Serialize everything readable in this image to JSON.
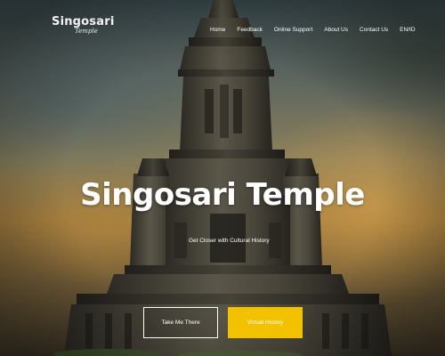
{
  "logo": {
    "main": "Singosari",
    "sub": "Temple"
  },
  "nav": {
    "items": [
      {
        "label": "Home"
      },
      {
        "label": "Feedback"
      },
      {
        "label": "Online Support"
      },
      {
        "label": "About Us"
      },
      {
        "label": "Contact Us"
      },
      {
        "label": "EN/ID"
      }
    ]
  },
  "hero": {
    "title": "Singosari Temple",
    "subtitle": "Get Closer with Cultural History",
    "primary_button": "Take Me There",
    "secondary_button": "Virtual History"
  },
  "colors": {
    "accent": "#f2c200",
    "text": "#ffffff"
  }
}
